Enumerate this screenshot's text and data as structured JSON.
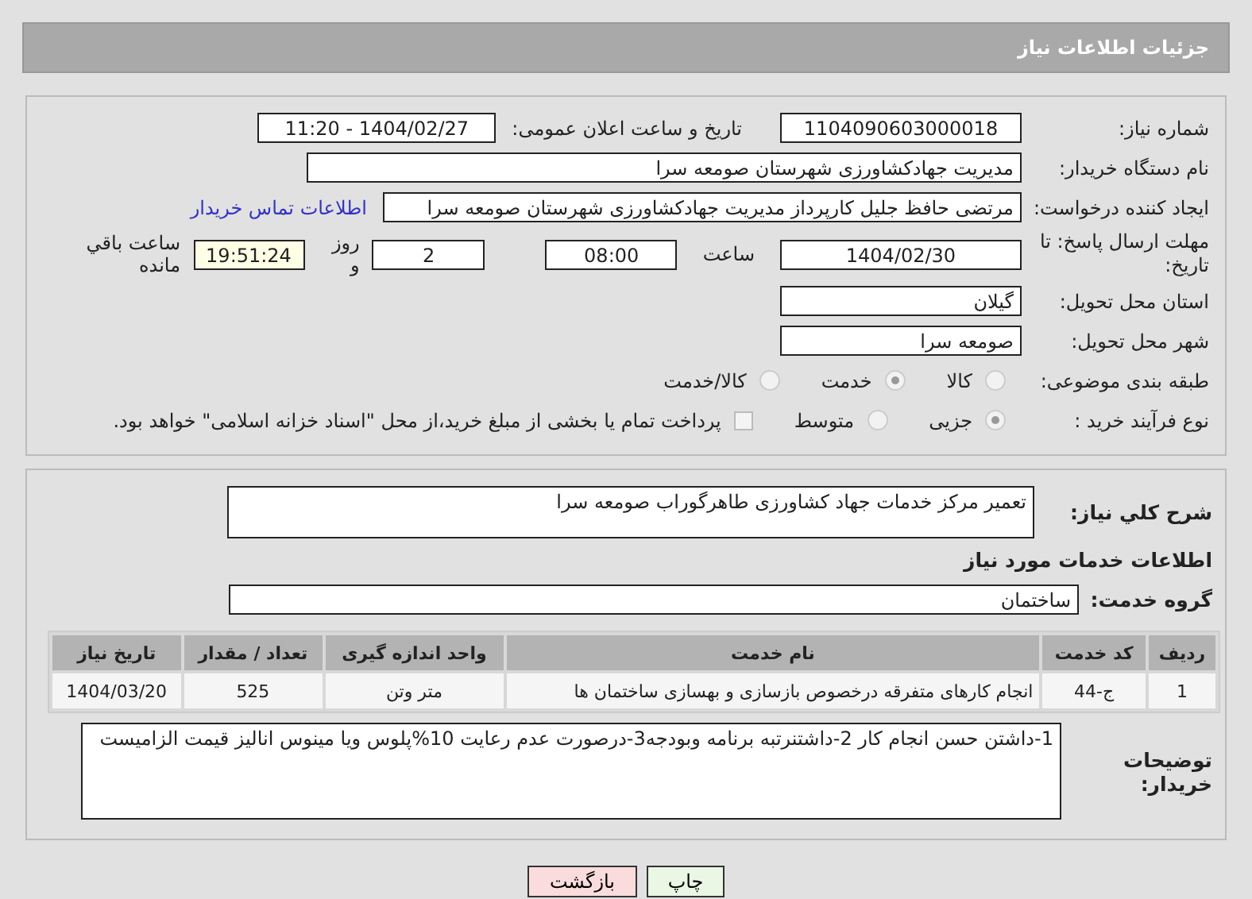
{
  "header": {
    "title": "جزئیات اطلاعات نیاز"
  },
  "need_number": {
    "label": "شماره نیاز:",
    "value": "1104090603000018"
  },
  "announcement": {
    "label": "تاریخ و ساعت اعلان عمومی:",
    "value": "1404/02/27 - 11:20"
  },
  "buyer_org": {
    "label": "نام دستگاه خریدار:",
    "value": "مدیریت جهادکشاورزی شهرستان صومعه سرا"
  },
  "creator": {
    "label": "ایجاد کننده درخواست:",
    "value": "مرتضی حافظ جلیل کارپرداز مدیریت جهادکشاورزی شهرستان صومعه سرا",
    "contact_link": "اطلاعات تماس خریدار"
  },
  "deadline": {
    "label": "مهلت ارسال پاسخ: تا تاریخ:",
    "date": "1404/02/30",
    "time_label": "ساعت",
    "time": "08:00",
    "days": "2",
    "days_label": "روز و",
    "remaining": "19:51:24",
    "remaining_label": "ساعت باقي مانده"
  },
  "province": {
    "label": "استان محل تحویل:",
    "value": "گیلان"
  },
  "city": {
    "label": "شهر محل تحویل:",
    "value": "صومعه سرا"
  },
  "category": {
    "label": "طبقه بندی موضوعی:",
    "options": [
      {
        "label": "کالا",
        "selected": false
      },
      {
        "label": "خدمت",
        "selected": true
      },
      {
        "label": "کالا/خدمت",
        "selected": false
      }
    ]
  },
  "process": {
    "label": "نوع فرآیند خرید :",
    "options": [
      {
        "label": "جزیی",
        "selected": true
      },
      {
        "label": "متوسط",
        "selected": false
      }
    ],
    "payment": {
      "label": "پرداخت تمام یا بخشی از مبلغ خرید،از محل \"اسناد خزانه اسلامی\" خواهد بود.",
      "checked": false
    }
  },
  "description": {
    "label": "شرح کلي نياز:",
    "value": "تعمیر مرکز خدمات جهاد کشاورزی طاهرگوراب صومعه سرا"
  },
  "services_heading": "اطلاعات خدمات مورد نیاز",
  "service_group": {
    "label": "گروه خدمت:",
    "value": "ساختمان"
  },
  "table": {
    "columns": [
      "ردیف",
      "کد خدمت",
      "نام خدمت",
      "واحد اندازه گیری",
      "تعداد / مقدار",
      "تاریخ نیاز"
    ],
    "rows": [
      [
        "1",
        "ج-44",
        "انجام کارهای متفرقه درخصوص بازسازی و بهسازی ساختمان ها",
        "متر وتن",
        "525",
        "1404/03/20"
      ]
    ]
  },
  "buyer_notes": {
    "label": "توضیحات خریدار:",
    "value": "1-داشتن حسن انجام کار 2-داشتنرتبه برنامه وبودجه3-درصورت عدم رعایت 10%پلوس ویا مینوس انالیز قیمت الزامیست"
  },
  "buttons": [
    {
      "label": "چاپ",
      "kind": "print"
    },
    {
      "label": "بازگشت",
      "kind": "back"
    }
  ]
}
